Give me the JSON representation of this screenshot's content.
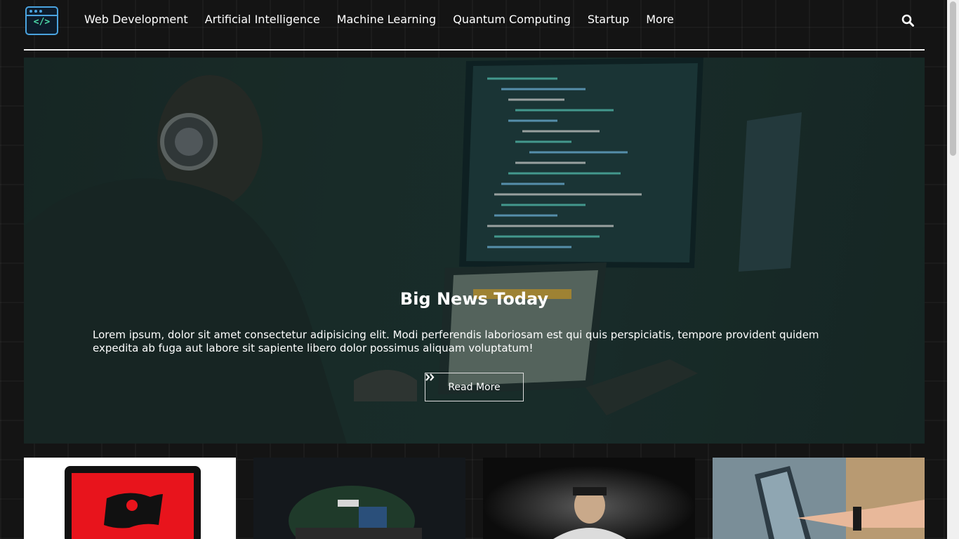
{
  "nav": {
    "logo": {
      "icon": "code-window-icon",
      "code_glyph": "</>"
    },
    "links": [
      "Web Development",
      "Artificial Intelligence",
      "Machine Learning",
      "Quantum Computing",
      "Startup",
      "More"
    ],
    "search_icon": "search-icon"
  },
  "hero": {
    "title": "Big News Today",
    "text": "Lorem ipsum, dolor sit amet consectetur adipisicing elit. Modi perferendis laboriosam est qui quis perspiciatis, tempore provident quidem expedita ab fuga aut labore sit sapiente libero dolor possimus aliquam voluptatum!",
    "button_label": "Read More",
    "button_icon": "double-chevron-right-icon"
  },
  "cards": [
    {
      "image": "pirate-flag-laptop"
    },
    {
      "image": "desk-setup-dark"
    },
    {
      "image": "person-in-dark"
    },
    {
      "image": "hand-touching-laptop"
    }
  ],
  "colors": {
    "background": "#141414",
    "logo_border": "#4aa3df",
    "logo_code": "#4cd7a6",
    "rule": "#f2f2f2"
  }
}
